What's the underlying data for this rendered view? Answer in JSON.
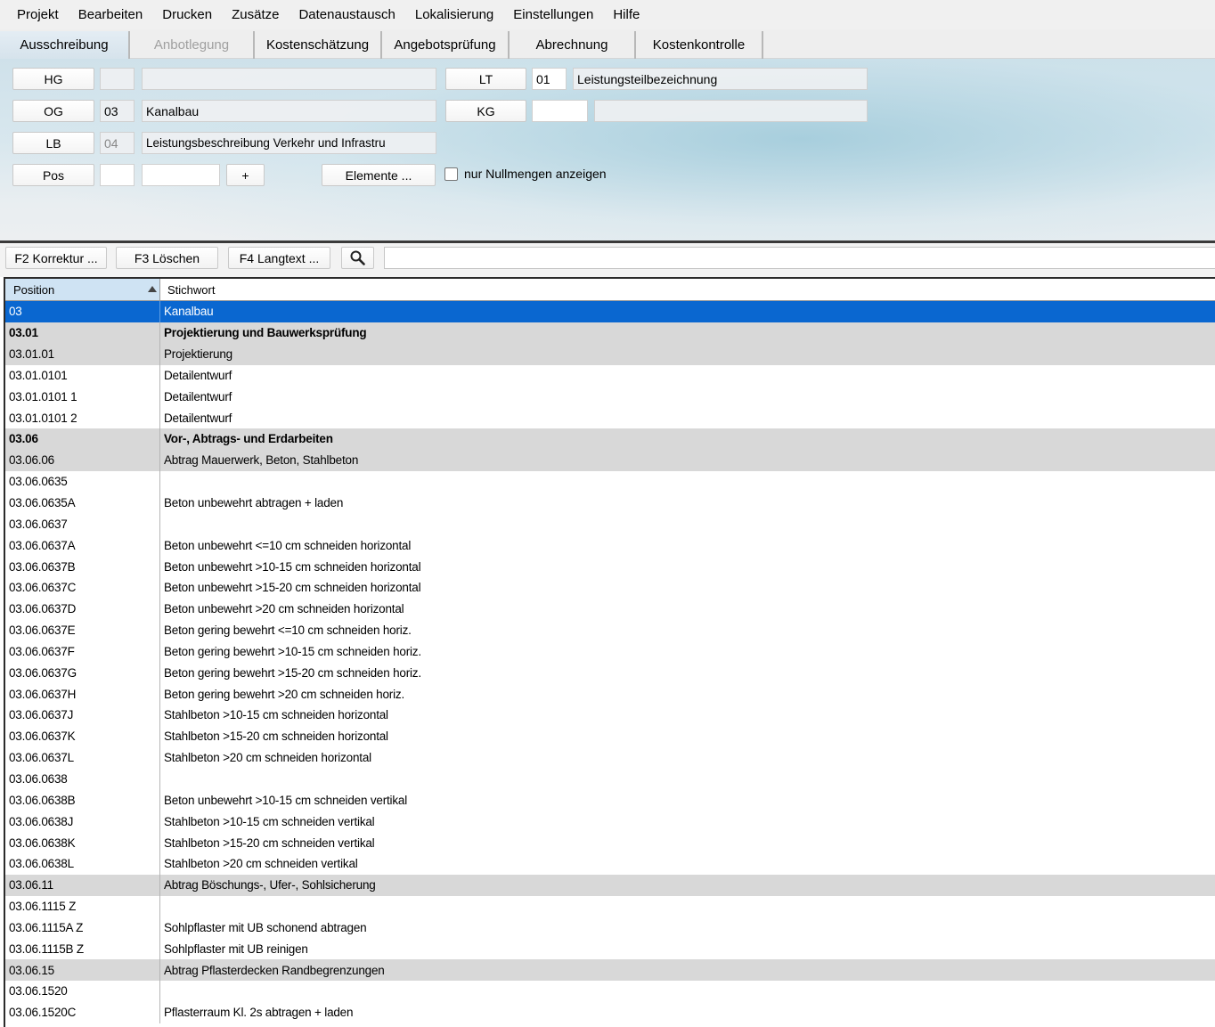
{
  "menu": [
    "Projekt",
    "Bearbeiten",
    "Drucken",
    "Zusätze",
    "Datenaustausch",
    "Lokalisierung",
    "Einstellungen",
    "Hilfe"
  ],
  "tabs": [
    {
      "label": "Ausschreibung",
      "state": "active"
    },
    {
      "label": "Anbotlegung",
      "state": "disabled"
    },
    {
      "label": "Kostenschätzung",
      "state": "normal"
    },
    {
      "label": "Angebotsprüfung",
      "state": "normal"
    },
    {
      "label": "Abrechnung",
      "state": "normal"
    },
    {
      "label": "Kostenkontrolle",
      "state": "normal"
    }
  ],
  "header": {
    "hg": {
      "label": "HG",
      "code": "",
      "name": ""
    },
    "og": {
      "label": "OG",
      "code": "03",
      "name": "Kanalbau"
    },
    "lb": {
      "label": "LB",
      "code": "04",
      "name": "Leistungsbeschreibung Verkehr und Infrastru"
    },
    "lt": {
      "label": "LT",
      "code": "01",
      "name": "Leistungsteilbezeichnung"
    },
    "kg": {
      "label": "KG",
      "code": "",
      "name": ""
    },
    "pos": {
      "label": "Pos",
      "code": "",
      "value": "",
      "plus_label": "+"
    },
    "elements_label": "Elemente ...",
    "null_check_label": "nur Nullmengen anzeigen",
    "null_check_checked": false
  },
  "toolbar": {
    "korrektur_label": "F2 Korrektur ...",
    "loeschen_label": "F3 Löschen",
    "langtext_label": "F4 Langtext ...",
    "search_icon": "search-icon",
    "search_value": ""
  },
  "grid": {
    "columns": {
      "position": "Position",
      "stichwort": "Stichwort"
    },
    "sort": "position-ascending",
    "selected_color": "#0a67d0",
    "group_color": "#d8d8d8",
    "rows": [
      {
        "pos": "03",
        "text": "Kanalbau",
        "kind": "selected"
      },
      {
        "pos": "03.01",
        "text": "Projektierung und Bauwerksprüfung",
        "kind": "group-bold"
      },
      {
        "pos": "03.01.01",
        "text": "Projektierung",
        "kind": "group"
      },
      {
        "pos": "03.01.0101",
        "text": "Detailentwurf",
        "kind": "item"
      },
      {
        "pos": "03.01.0101 1",
        "text": "Detailentwurf",
        "kind": "item"
      },
      {
        "pos": "03.01.0101 2",
        "text": "Detailentwurf",
        "kind": "item"
      },
      {
        "pos": "03.06",
        "text": "Vor-, Abtrags- und Erdarbeiten",
        "kind": "group-bold"
      },
      {
        "pos": "03.06.06",
        "text": "Abtrag Mauerwerk, Beton, Stahlbeton",
        "kind": "group"
      },
      {
        "pos": "03.06.0635",
        "text": "",
        "kind": "item"
      },
      {
        "pos": "03.06.0635A",
        "text": "Beton unbewehrt abtragen + laden",
        "kind": "item"
      },
      {
        "pos": "03.06.0637",
        "text": "",
        "kind": "item"
      },
      {
        "pos": "03.06.0637A",
        "text": "Beton unbewehrt <=10 cm schneiden horizontal",
        "kind": "item"
      },
      {
        "pos": "03.06.0637B",
        "text": "Beton unbewehrt >10-15 cm schneiden horizontal",
        "kind": "item"
      },
      {
        "pos": "03.06.0637C",
        "text": "Beton unbewehrt >15-20 cm schneiden horizontal",
        "kind": "item"
      },
      {
        "pos": "03.06.0637D",
        "text": "Beton unbewehrt >20 cm schneiden horizontal",
        "kind": "item"
      },
      {
        "pos": "03.06.0637E",
        "text": "Beton gering bewehrt <=10 cm schneiden horiz.",
        "kind": "item"
      },
      {
        "pos": "03.06.0637F",
        "text": "Beton gering bewehrt >10-15 cm schneiden horiz.",
        "kind": "item"
      },
      {
        "pos": "03.06.0637G",
        "text": "Beton gering bewehrt >15-20 cm schneiden horiz.",
        "kind": "item"
      },
      {
        "pos": "03.06.0637H",
        "text": "Beton gering bewehrt >20 cm schneiden horiz.",
        "kind": "item"
      },
      {
        "pos": "03.06.0637J",
        "text": "Stahlbeton >10-15 cm schneiden horizontal",
        "kind": "item"
      },
      {
        "pos": "03.06.0637K",
        "text": "Stahlbeton >15-20 cm schneiden horizontal",
        "kind": "item"
      },
      {
        "pos": "03.06.0637L",
        "text": "Stahlbeton >20 cm schneiden horizontal",
        "kind": "item"
      },
      {
        "pos": "03.06.0638",
        "text": "",
        "kind": "item"
      },
      {
        "pos": "03.06.0638B",
        "text": "Beton unbewehrt >10-15 cm schneiden vertikal",
        "kind": "item"
      },
      {
        "pos": "03.06.0638J",
        "text": "Stahlbeton >10-15 cm schneiden vertikal",
        "kind": "item"
      },
      {
        "pos": "03.06.0638K",
        "text": "Stahlbeton >15-20 cm schneiden vertikal",
        "kind": "item"
      },
      {
        "pos": "03.06.0638L",
        "text": "Stahlbeton >20 cm schneiden vertikal",
        "kind": "item"
      },
      {
        "pos": "03.06.11",
        "text": "Abtrag Böschungs-, Ufer-, Sohlsicherung",
        "kind": "group"
      },
      {
        "pos": "03.06.1115  Z",
        "text": "",
        "kind": "item"
      },
      {
        "pos": "03.06.1115A  Z",
        "text": "Sohlpflaster mit UB schonend abtragen",
        "kind": "item"
      },
      {
        "pos": "03.06.1115B  Z",
        "text": "Sohlpflaster mit UB reinigen",
        "kind": "item"
      },
      {
        "pos": "03.06.15",
        "text": "Abtrag Pflasterdecken Randbegrenzungen",
        "kind": "group"
      },
      {
        "pos": "03.06.1520",
        "text": "",
        "kind": "item"
      },
      {
        "pos": "03.06.1520C",
        "text": "Pflasterraum Kl. 2s abtragen + laden",
        "kind": "item"
      }
    ]
  }
}
